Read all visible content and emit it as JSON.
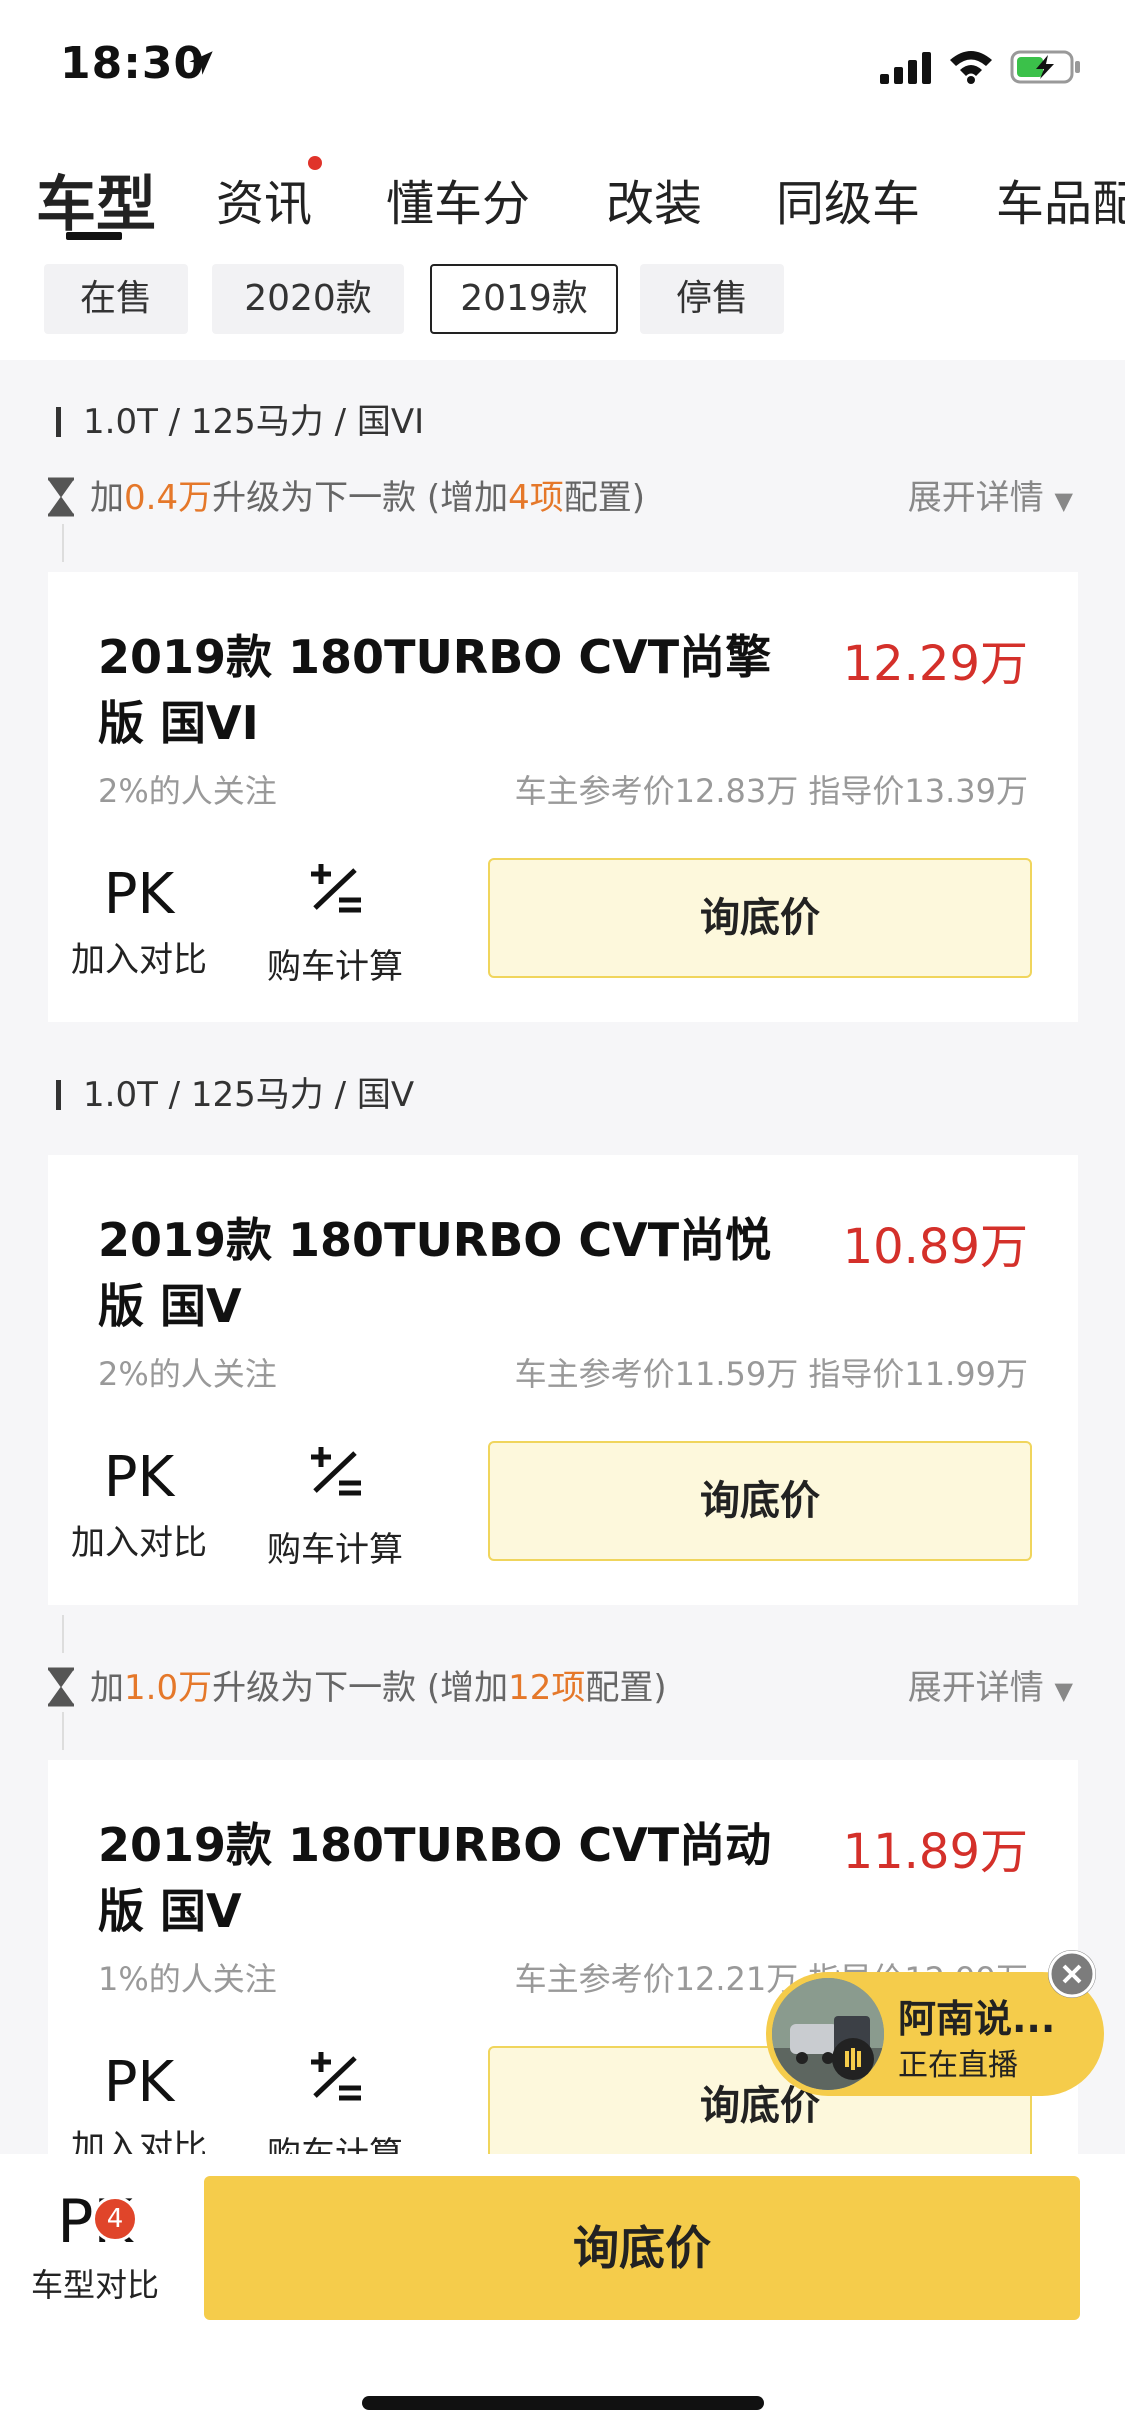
{
  "status_bar": {
    "time": "18:30"
  },
  "tabs": [
    {
      "label": "车型",
      "active": true
    },
    {
      "label": "资讯",
      "dot": true
    },
    {
      "label": "懂车分"
    },
    {
      "label": "改装"
    },
    {
      "label": "同级车"
    },
    {
      "label": "车品配"
    }
  ],
  "year_filters": [
    "在售",
    "2020款",
    "2019款",
    "停售"
  ],
  "selected_year": "2019款",
  "groups": [
    {
      "label": "1.0T / 125马力 / 国VI"
    },
    {
      "label": "1.0T / 125马力 / 国V"
    }
  ],
  "upgrades": [
    {
      "prefix": "加",
      "amount": "0.4万",
      "middle": "升级为下一款 (增加",
      "count": "4项",
      "suffix": "配置)",
      "expand": "展开详情"
    },
    {
      "prefix": "加",
      "amount": "1.0万",
      "middle": "升级为下一款 (增加",
      "count": "12项",
      "suffix": "配置)",
      "expand": "展开详情"
    }
  ],
  "cards": [
    {
      "title": "2019款 180TURBO CVT尚擎版 国VI",
      "price": "12.29万",
      "follow": "2%的人关注",
      "ref": "车主参考价12.83万 指导价13.39万"
    },
    {
      "title": "2019款 180TURBO CVT尚悦版 国V",
      "price": "10.89万",
      "follow": "2%的人关注",
      "ref": "车主参考价11.59万 指导价11.99万"
    },
    {
      "title": "2019款 180TURBO CVT尚动版 国V",
      "price": "11.89万",
      "follow": "1%的人关注",
      "ref": "车主参考价12.21万 指导价12.99万"
    }
  ],
  "actions": {
    "pk_icon": "PK",
    "pk_label": "加入对比",
    "calc_label": "购车计算",
    "ask_label": "询底价"
  },
  "bottom_bar": {
    "pk_icon": "PK",
    "badge": "4",
    "pk_label": "车型对比",
    "ask_label": "询底价"
  },
  "live": {
    "name": "阿南说...",
    "status": "正在直播"
  },
  "colors": {
    "price": "#d4302a",
    "accent_orange": "#e5782a",
    "cta_yellow": "#f5cc4b"
  }
}
